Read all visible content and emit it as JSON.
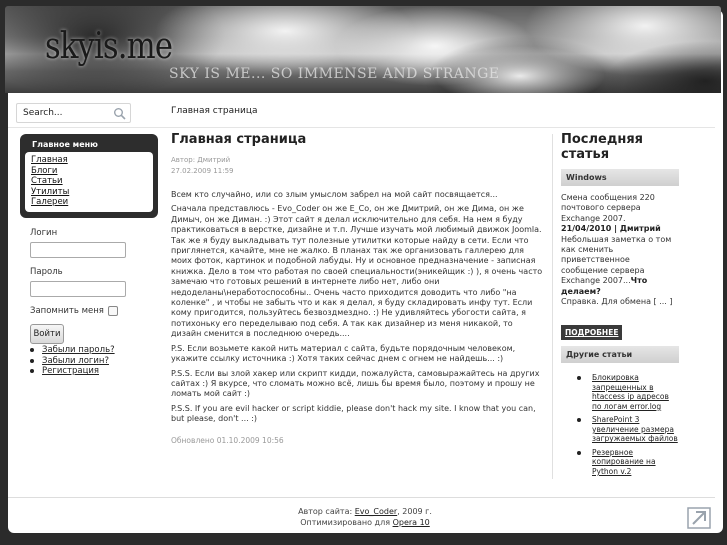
{
  "site": {
    "title": "skyis.me",
    "slogan": "SKY IS ME... SO IMMENSE AND STRANGE"
  },
  "search": {
    "placeholder": "Search..."
  },
  "breadcrumb": "Главная страница",
  "main_menu": {
    "title": "Главное меню",
    "items": [
      "Главная",
      "Блоги",
      "Статьи",
      "Утилиты",
      "Галереи"
    ]
  },
  "login": {
    "username_label": "Логин",
    "password_label": "Пароль",
    "remember_label": "Запомнить меня",
    "button_label": "Войти",
    "links": [
      "Забыли пароль?",
      "Забыли логин?",
      "Регистрация"
    ]
  },
  "article": {
    "title": "Главная страница",
    "author": "Автор: Дмитрий",
    "date": "27.02.2009 11:59",
    "intro": "Всем кто случайно, или со злым умыслом забрел на мой сайт посвящается...",
    "body": "Сначала представлюсь - Evo_Coder он же E_Co, он же Дмитрий, он же Дима, он же Димыч, он же Диман. :) Этот сайт я делал исключительно для себя. На нем я буду практиковаться в верстке, дизайне и т.п. Лучше изучать мой любимый движок Joomla. Так же я буду выкладывать тут полезные утилитки которые найду в сети. Если что приглянется, качайте, мне не жалко. В планах так же организовать галлерею для моих фоток, картинок и подобной лабуды. Ну и основное предназначение - записная книжка. Дело в том что работая по своей специальности(эникейщик :) ), я очень часто замечаю что готовых решений в интернете либо нет, либо они недоделаны\\неработоспособны.. Очень часто приходится доводить что либо \"на коленке\" , и чтобы не забыть что и как я делал, я буду складировать инфу тут. Если кому пригодится, пользуйтесь безвоздмездно. :) Не удивляйтесь убогости сайта, я потихоньку его переделываю под себя. А так как дизайнер из меня никакой, то дизайн сменится в последнюю очередь....",
    "ps": "P.S. Если возьмете какой нить материал с сайта, будьте порядочным человеком, укажите ссылку источника :) Хотя таких сейчас днем с огнем не найдешь... :)",
    "pss": "P.S.S. Если вы злой хакер или скрипт кидди, пожалуйста, самовыражайтесь на других сайтах :) Я вкурсе, что сломать можно всё, лишь бы время было, поэтому и прошу не ломать мой сайт :)",
    "pss_en": "P.S.S. If you are evil hacker or script kiddie, please don't hack my site. I know that you can, but please, don't ... :)",
    "updated": "Обновлено 01.10.2009 10:56"
  },
  "latest": {
    "heading": "Последняя статья",
    "category": "Windows",
    "text1": "Смена сообщения 220 почтового сервера Exchange 2007.",
    "date_author": "21/04/2010 | Дмитрий",
    "text2": "Небольшая заметка о том как сменить приветственное сообщение сервера Exchange 2007...",
    "question": "Что делаем?",
    "text3": "Справка. Для обмена [ ... ]",
    "more_label": "ПОДРОБНЕЕ"
  },
  "other": {
    "heading": "Другие статьи",
    "items": [
      "Блокировка запрещенных в htaccess ip адресов по логам error.log",
      "SharePoint 3 увеличение размера загружаемых файлов",
      "Резервное копирование на Python v.2"
    ]
  },
  "footer": {
    "author_prefix": "Автор сайта:",
    "author_link": "Evo_Coder",
    "author_suffix": ", 2009 г.",
    "optimized_prefix": "Оптимизировано для",
    "optimized_link": "Opera 10"
  }
}
